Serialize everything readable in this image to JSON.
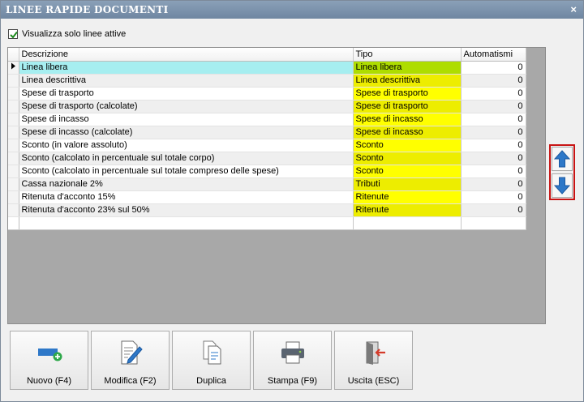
{
  "window": {
    "title": "LINEE RAPIDE DOCUMENTI",
    "close_glyph": "×"
  },
  "filter": {
    "label": "Visualizza solo linee attive",
    "checked": true
  },
  "grid": {
    "columns": [
      "Descrizione",
      "Tipo",
      "Automatismi"
    ],
    "rows": [
      {
        "descrizione": "Linea libera",
        "tipo": "Linea libera",
        "automatismi": "0"
      },
      {
        "descrizione": "Linea descrittiva",
        "tipo": "Linea descrittiva",
        "automatismi": "0"
      },
      {
        "descrizione": "Spese di trasporto",
        "tipo": "Spese di trasporto",
        "automatismi": "0"
      },
      {
        "descrizione": "Spese di trasporto (calcolate)",
        "tipo": "Spese di trasporto",
        "automatismi": "0"
      },
      {
        "descrizione": "Spese di incasso",
        "tipo": "Spese di incasso",
        "automatismi": "0"
      },
      {
        "descrizione": "Spese di incasso (calcolate)",
        "tipo": "Spese di incasso",
        "automatismi": "0"
      },
      {
        "descrizione": "Sconto (in valore assoluto)",
        "tipo": "Sconto",
        "automatismi": "0"
      },
      {
        "descrizione": "Sconto (calcolato in percentuale sul totale corpo)",
        "tipo": "Sconto",
        "automatismi": "0"
      },
      {
        "descrizione": "Sconto (calcolato in percentuale sul totale compreso delle spese)",
        "tipo": "Sconto",
        "automatismi": "0"
      },
      {
        "descrizione": "Cassa nazionale 2%",
        "tipo": "Tributi",
        "automatismi": "0"
      },
      {
        "descrizione": "Ritenuta d'acconto 15%",
        "tipo": "Ritenute",
        "automatismi": "0"
      },
      {
        "descrizione": "Ritenuta d'acconto 23% sul 50%",
        "tipo": "Ritenute",
        "automatismi": "0"
      }
    ],
    "current_row": 0,
    "row_indicator_icon": "current-row-arrow-icon"
  },
  "side_controls": {
    "up_icon": "move-up-arrow-icon",
    "down_icon": "move-down-arrow-icon",
    "highlight_color": "#c81414"
  },
  "buttons": {
    "nuovo": {
      "label": "Nuovo (F4)",
      "icon": "new-line-icon"
    },
    "modifica": {
      "label": "Modifica (F2)",
      "icon": "edit-document-icon"
    },
    "duplica": {
      "label": "Duplica",
      "icon": "duplicate-icon"
    },
    "stampa": {
      "label": "Stampa (F9)",
      "icon": "printer-icon"
    },
    "uscita": {
      "label": "Uscita (ESC)",
      "icon": "exit-door-icon"
    }
  },
  "colors": {
    "accent_blue": "#2e78c8",
    "tipo_yellow": "#ffff00",
    "tipo_selected_green": "#aedd00",
    "desc_selected_cyan": "#a6eef0"
  }
}
